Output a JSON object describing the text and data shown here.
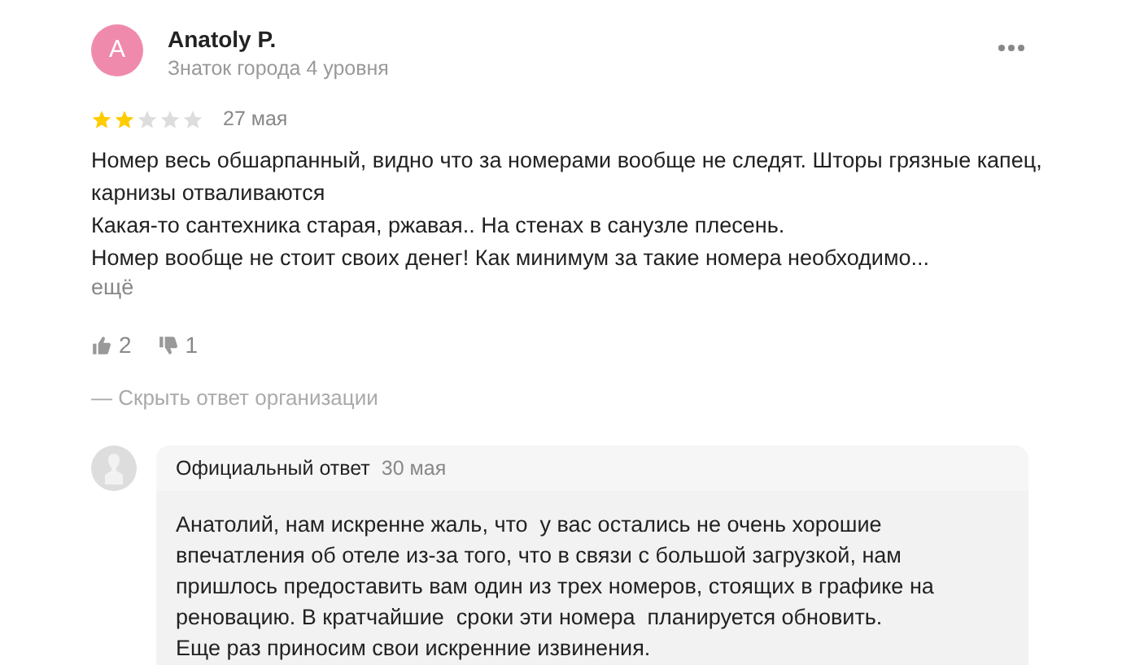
{
  "review": {
    "avatar_letter": "A",
    "author": "Anatoly P.",
    "level": "Знаток города 4 уровня",
    "stars": 2,
    "date": "27 мая",
    "paragraphs": [
      "Номер весь обшарпанный, видно что за номерами вообще не следят. Шторы грязные капец, карнизы отваливаются",
      "Какая-то сантехника старая, ржавая.. На стенах в санузле плесень.",
      "Номер вообще не стоит своих денег! Как минимум за такие номера необходимо..."
    ],
    "more": "ещё",
    "likes": "2",
    "dislikes": "1",
    "hide_reply": "— Скрыть ответ организации"
  },
  "reply": {
    "title": "Официальный ответ",
    "date": "30 мая",
    "paragraphs": [
      "Анатолий, нам искренне жаль, что  у вас остались не очень хорошие впечатления об отеле из-за того, что в связи с большой загрузкой, нам пришлось предоставить вам один из трех номеров, стоящих в графике на реновацию. В кратчайшие  сроки эти номера  планируется обновить.",
      "Еще раз приносим свои искренние извинения."
    ]
  }
}
